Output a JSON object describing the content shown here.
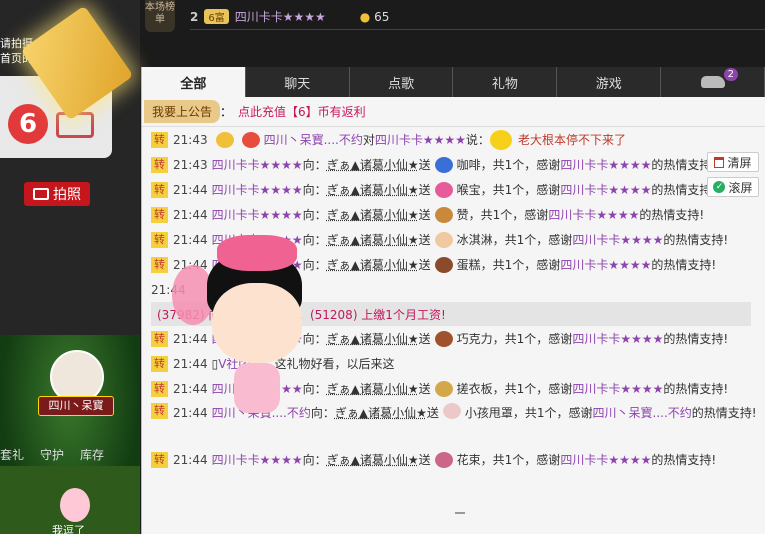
{
  "left": {
    "promo_line1": "请拍摄一张带",
    "promo_line2": "首页的宣传语",
    "photo_label": "拍照",
    "avatar_name": "四川丶呆寳",
    "nav": [
      "套礼",
      "守护",
      "库存"
    ],
    "bottom_label": "我逗了"
  },
  "rank": {
    "tab_label": "本场榜单",
    "rank": "2",
    "badge": "6富",
    "user": "四川卡卡★★★★",
    "coins": "65"
  },
  "tabs": [
    "全部",
    "聊天",
    "点歌",
    "礼物",
    "游戏"
  ],
  "car_badge": "2",
  "announce": {
    "button": "我要上公告",
    "text": "点此充值【6】币有返利"
  },
  "controls": {
    "clear": "清屏",
    "lock": "滚屏"
  },
  "messages": [
    {
      "kind": "say",
      "time": "21:43",
      "user": "四川丶呆寳....不约",
      "mid": "对",
      "target": "四川卡卡★★★★",
      "verb": "说：",
      "text": "老大根本停不下来了"
    },
    {
      "kind": "gift",
      "time": "21:43",
      "user": "四川卡卡★★★★",
      "to": "ぎぁ▲诸葛小仙★",
      "gift": "咖啡，共1个，感谢",
      "thanks": "四川卡卡★★★★",
      "end": "的热情支持!"
    },
    {
      "kind": "gift",
      "time": "21:44",
      "user": "四川卡卡★★★★",
      "to": "ぎぁ▲诸葛小仙★",
      "gift": "喉宝，共1个，感谢",
      "thanks": "四川卡卡★★★★",
      "end": "的热情支持!"
    },
    {
      "kind": "gift",
      "time": "21:44",
      "user": "四川卡卡★★★★",
      "to": "ぎぁ▲诸葛小仙★",
      "gift": "赞，共1个，感谢",
      "thanks": "四川卡卡★★★★",
      "end": "的热情支持!"
    },
    {
      "kind": "gift",
      "time": "21:44",
      "user": "四川卡卡★★★★",
      "to": "ぎぁ▲诸葛小仙★",
      "gift": "冰淇淋，共1个，感谢",
      "thanks": "四川卡卡★★★★",
      "end": "的热情支持!"
    },
    {
      "kind": "gift",
      "time": "21:44",
      "user": "四川卡卡★★★★",
      "to": "ぎぁ▲诸葛小仙★",
      "gift": "蛋糕，共1个，感谢",
      "thanks": "四川卡卡★★★★",
      "end": "的热情支持!"
    },
    {
      "kind": "time_only",
      "time": "21:44"
    },
    {
      "kind": "sys",
      "text": "(37982) 向 ✿✿小思雨❥. 。(51208) 上缴1个月工资!"
    },
    {
      "kind": "gift",
      "time": "21:44",
      "user": "四川卡卡★★★★",
      "to": "ぎぁ▲诸葛小仙★",
      "gift": "巧克力，共1个，感谢",
      "thanks": "四川卡卡★★★★",
      "end": "的热情支持!"
    },
    {
      "kind": "chat",
      "time": "21:44",
      "user": "V社团一",
      "text": "这礼物好看，以后来这"
    },
    {
      "kind": "gift",
      "time": "21:44",
      "user": "四川卡卡★★★★",
      "to": "ぎぁ▲诸葛小仙★",
      "gift": "搓衣板，共1个，感谢",
      "thanks": "四川卡卡★★★★",
      "end": "的热情支持!"
    },
    {
      "kind": "gift_tall",
      "time": "21:44",
      "user": "四川丶呆寳....不约",
      "to": "ぎぁ▲诸葛小仙★",
      "gift": "小孩甩罩，共1个，感谢",
      "thanks": "四川丶呆寳....不约",
      "end": "的热情支持!"
    },
    {
      "kind": "gift",
      "time": "21:44",
      "user": "四川卡卡★★★★",
      "to": "ぎぁ▲诸葛小仙★",
      "gift": "花束，共1个，感谢",
      "thanks": "四川卡卡★★★★",
      "end": "的热情支持!"
    }
  ],
  "labels": {
    "zhuan": "转",
    "to_word": "向：",
    "send_word": "送"
  },
  "colors": {
    "user": "#8e44ad",
    "accent": "#c2185b",
    "zhuan_bg": "#f4d03f",
    "tab_bg": "#2a2a2a"
  }
}
